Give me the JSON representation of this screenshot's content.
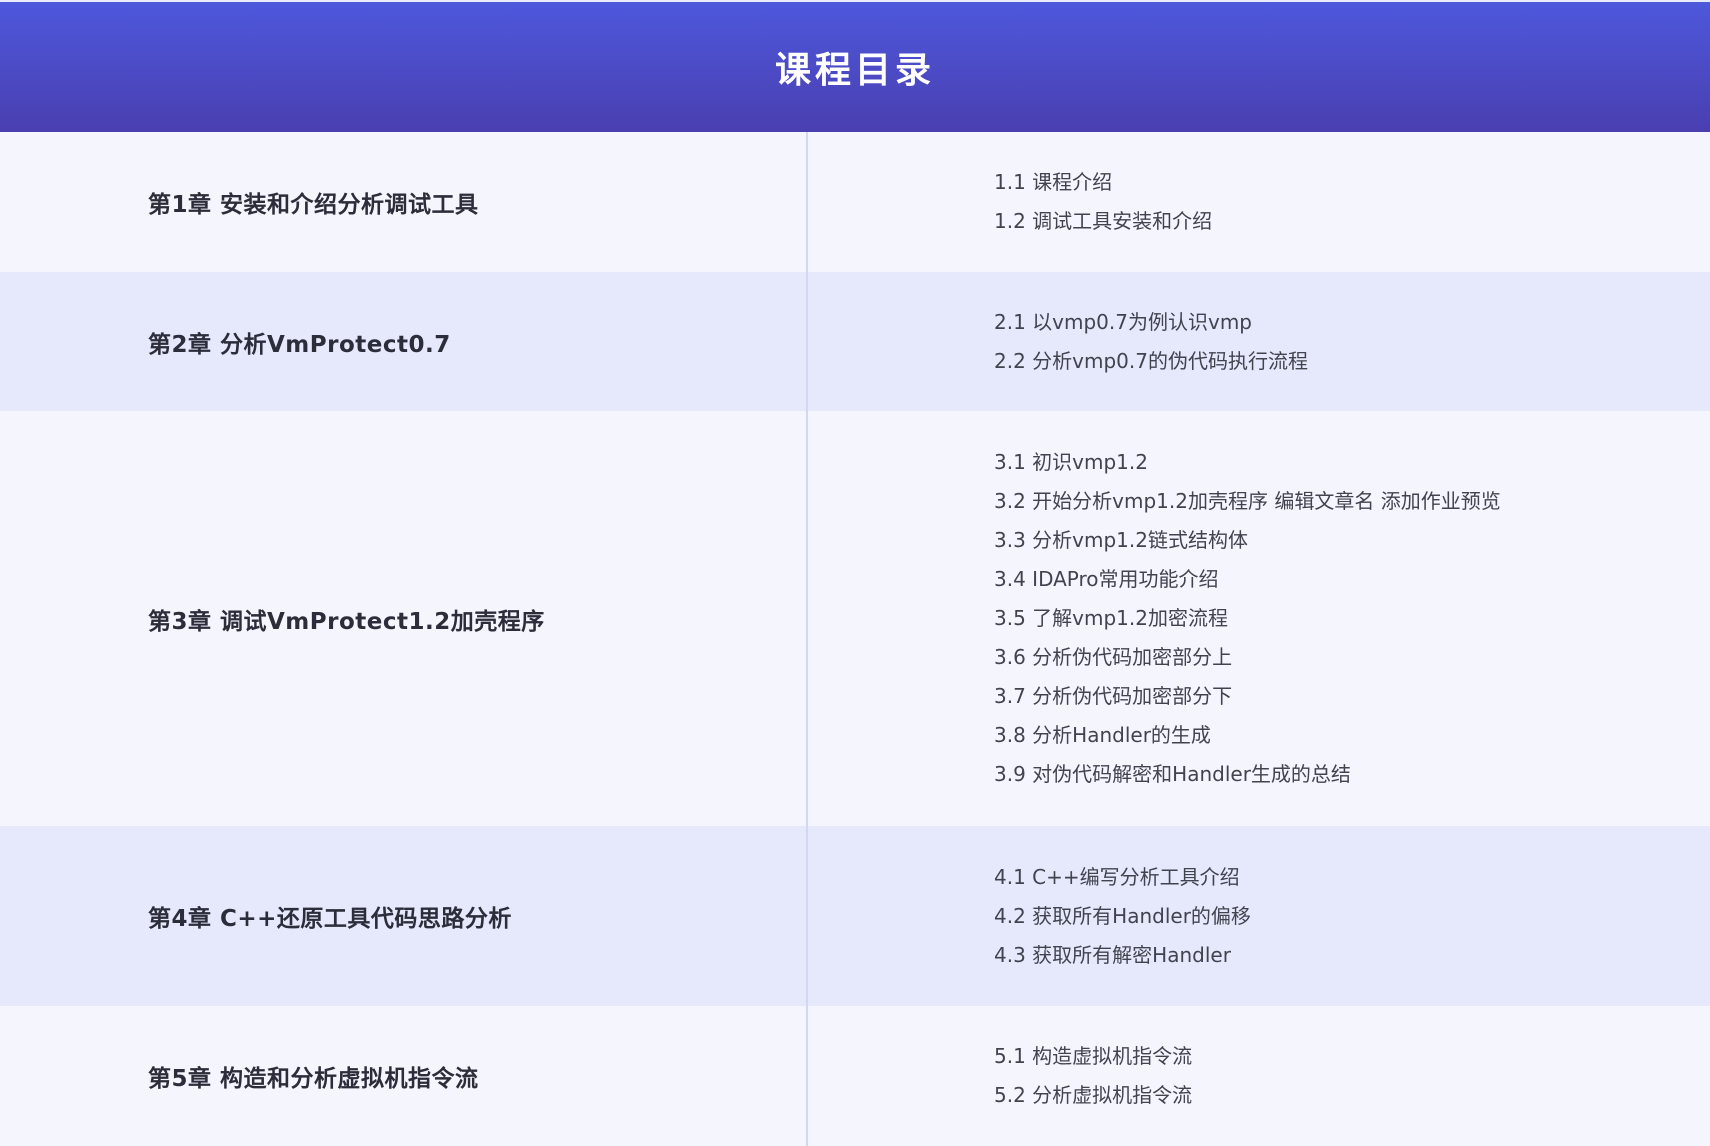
{
  "header": {
    "title": "课程目录"
  },
  "chapters": [
    {
      "title": "第1章 安装和介绍分析调试工具",
      "lessons": [
        "1.1 课程介绍",
        "1.2 调试工具安装和介绍"
      ]
    },
    {
      "title": "第2章 分析VmProtect0.7",
      "lessons": [
        "2.1 以vmp0.7为例认识vmp",
        "2.2 分析vmp0.7的伪代码执行流程"
      ]
    },
    {
      "title": "第3章 调试VmProtect1.2加壳程序",
      "lessons": [
        "3.1 初识vmp1.2",
        "3.2 开始分析vmp1.2加壳程序 编辑文章名 添加作业预览",
        "3.3 分析vmp1.2链式结构体",
        "3.4 IDAPro常用功能介绍",
        "3.5 了解vmp1.2加密流程",
        "3.6 分析伪代码加密部分上",
        "3.7 分析伪代码加密部分下",
        "3.8 分析Handler的生成",
        "3.9 对伪代码解密和Handler生成的总结"
      ]
    },
    {
      "title": "第4章 C++还原工具代码思路分析",
      "lessons": [
        "4.1 C++编写分析工具介绍",
        "4.2 获取所有Handler的偏移",
        "4.3 获取所有解密Handler"
      ]
    },
    {
      "title": "第5章 构造和分析虚拟机指令流",
      "lessons": [
        "5.1 构造虚拟机指令流",
        "5.2 分析虚拟机指令流"
      ]
    }
  ],
  "colors": {
    "header_start": "#4d58dc",
    "header_end": "#4a3fb0",
    "row_light": "#f5f5fd",
    "row_tinted": "#e6e8fc",
    "divider": "#d3d7f2"
  }
}
